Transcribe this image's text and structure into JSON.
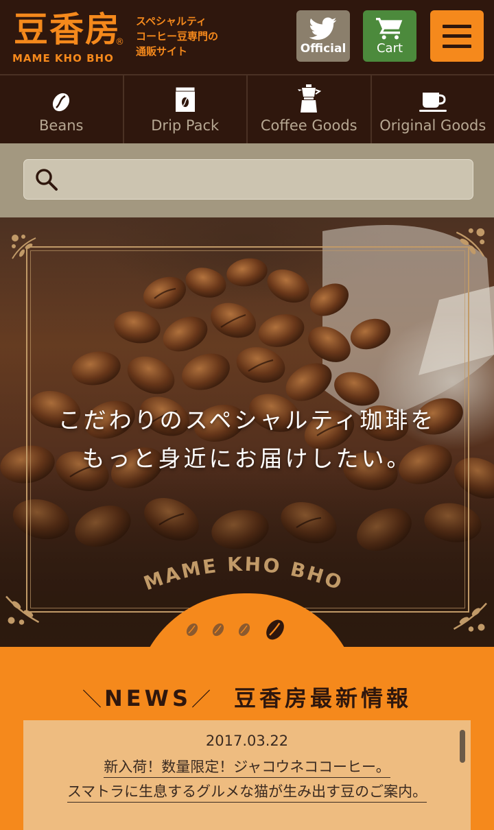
{
  "header": {
    "logo_jp": "豆香房",
    "logo_reg": "®",
    "logo_en": "MAME KHO BHO",
    "tagline_lines": [
      "スペシャルティ",
      "コーヒー豆専門の",
      "通販サイト"
    ],
    "twitter_label": "Official",
    "cart_label": "Cart"
  },
  "nav": {
    "items": [
      {
        "label": "Beans",
        "icon": "bean-icon"
      },
      {
        "label": "Drip Pack",
        "icon": "drip-pack-icon"
      },
      {
        "label": "Coffee Goods",
        "icon": "coffee-maker-icon"
      },
      {
        "label": "Original Goods",
        "icon": "cup-icon"
      }
    ]
  },
  "search": {
    "value": "",
    "placeholder": ""
  },
  "hero": {
    "line1": "こだわりのスペシャルティ珈琲を",
    "line2": "もっと身近にお届けしたい。",
    "brand": "MAME KHO BHO"
  },
  "news": {
    "heading_en": "NEWS",
    "heading_jp": "豆香房最新情報",
    "date": "2017.03.22",
    "line1": "新入荷！数量限定！ジャコウネココーヒー。",
    "line2": "スマトラに生息するグルメな猫が生み出す豆のご案内。"
  },
  "colors": {
    "brand_orange": "#f5891c",
    "dark_brown": "#2f170d",
    "cart_green": "#4c8a3c",
    "twitter_gray": "#8b7f6c"
  }
}
